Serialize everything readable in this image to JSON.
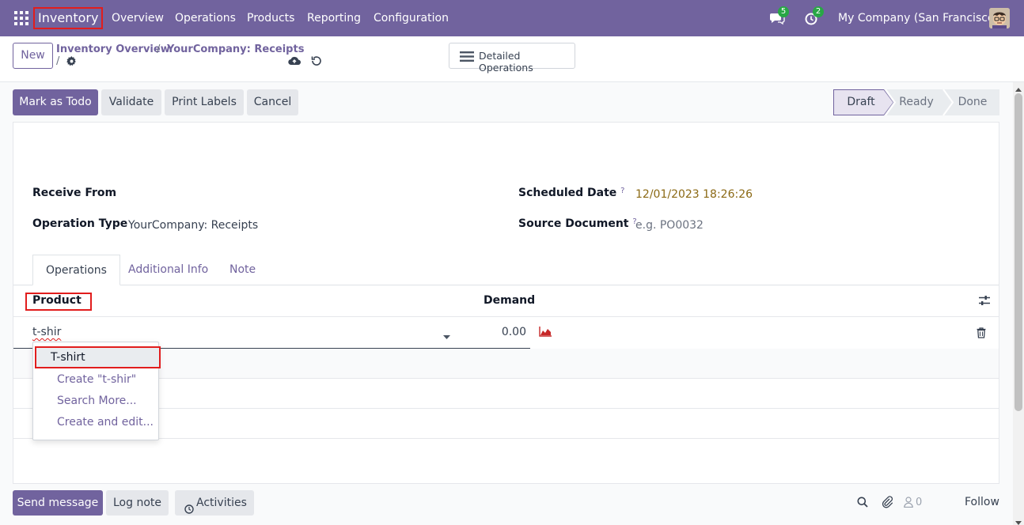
{
  "navbar": {
    "app_name": "Inventory",
    "menu": [
      "Overview",
      "Operations",
      "Products",
      "Reporting",
      "Configuration"
    ],
    "messages_count": "5",
    "activities_count": "2",
    "company": "My Company (San Francisco)"
  },
  "control": {
    "new_label": "New",
    "breadcrumb_parent": "Inventory Overview",
    "breadcrumb_current": "YourCompany: Receipts",
    "breadcrumb_sep": "/",
    "detailed_label": "Detailed Operations"
  },
  "actions": {
    "mark_todo": "Mark as Todo",
    "validate": "Validate",
    "print_labels": "Print Labels",
    "cancel": "Cancel"
  },
  "status_bar": {
    "stages": [
      "Draft",
      "Ready",
      "Done"
    ],
    "current": "Draft"
  },
  "form": {
    "receive_from_label": "Receive From",
    "operation_type_label": "Operation Type",
    "operation_type_value": "YourCompany: Receipts",
    "scheduled_date_label": "Scheduled Date",
    "scheduled_date_value": "12/01/2023 18:26:26",
    "source_document_label": "Source Document",
    "source_document_placeholder": "e.g. PO0032",
    "help_mark": "?"
  },
  "tabs": [
    "Operations",
    "Additional Info",
    "Note"
  ],
  "table": {
    "columns": [
      "Product",
      "Demand"
    ],
    "edit_row": {
      "product_input": "t-shir",
      "demand": "0.00"
    }
  },
  "autocomplete": {
    "items": [
      "T-shirt",
      "Create \"t-shir\"",
      "Search More...",
      "Create and edit..."
    ]
  },
  "chatter": {
    "send_message": "Send message",
    "log_note": "Log note",
    "activities": "Activities",
    "followers_count": "0",
    "follow": "Follow"
  },
  "colors": {
    "brand": "#71639e",
    "badge": "#28a745",
    "highlight": "#e11d1d",
    "date": "#8b6914"
  }
}
